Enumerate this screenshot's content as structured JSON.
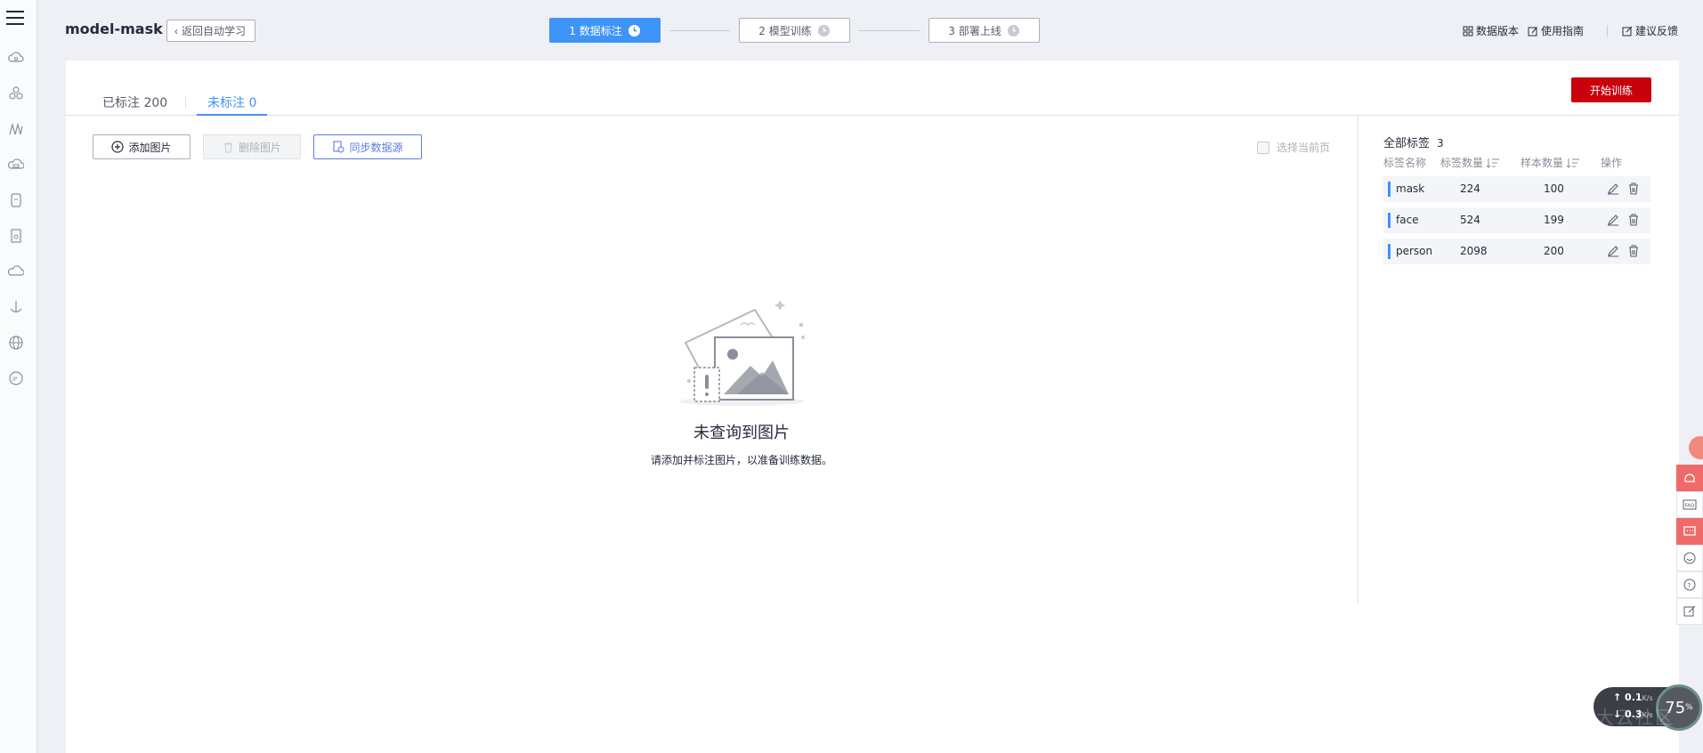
{
  "app": {
    "title": "model-mask",
    "back_label": "返回自动学习"
  },
  "steps": [
    {
      "label": "1 数据标注",
      "state": "active"
    },
    {
      "label": "2 模型训练",
      "state": "pending"
    },
    {
      "label": "3 部署上线",
      "state": "pending"
    }
  ],
  "top_links": {
    "data_version": "数据版本",
    "guide": "使用指南",
    "feedback": "建议反馈"
  },
  "tabs": {
    "labeled": "已标注 200",
    "unlabeled": "未标注 0"
  },
  "actions": {
    "start_training": "开始训练",
    "add_image": "添加图片",
    "delete_image": "删除图片",
    "sync_source": "同步数据源",
    "select_page": "选择当前页"
  },
  "empty": {
    "title": "未查询到图片",
    "subtitle": "请添加并标注图片，以准备训练数据。"
  },
  "labels_panel": {
    "title": "全部标签",
    "count": "3",
    "columns": {
      "name": "标签名称",
      "label_count": "标签数量",
      "sample_count": "样本数量",
      "ops": "操作"
    },
    "rows": [
      {
        "name": "mask",
        "label_count": "224",
        "sample_count": "100"
      },
      {
        "name": "face",
        "label_count": "524",
        "sample_count": "199"
      },
      {
        "name": "person",
        "label_count": "2098",
        "sample_count": "200"
      }
    ]
  },
  "side_tools": {
    "faq": "FAQ"
  },
  "net_widget": {
    "upload": "0.1",
    "download": "0.3",
    "unit_up": "K/s",
    "unit_down": "K/s",
    "percent": "75",
    "percent_unit": "%",
    "watermark": "大云社区"
  },
  "colors": {
    "accent": "#3e94f7",
    "primary_red": "#c7000b",
    "link_blue": "#5e7ce0"
  }
}
